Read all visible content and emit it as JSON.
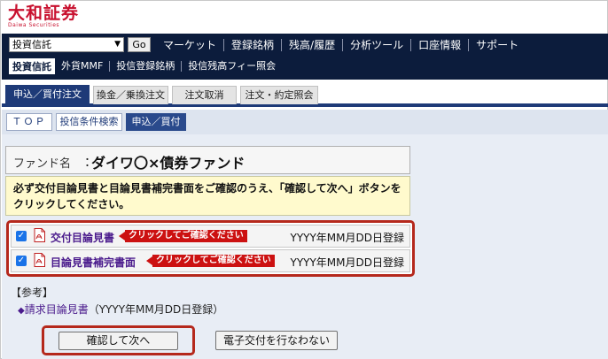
{
  "header": {
    "brand": "大和証券",
    "brand_en": "Daiwa Securities",
    "brand_color": "#c8102e"
  },
  "navbar": {
    "fund_select_value": "投資信託",
    "go_label": "Go",
    "main_items": [
      "マーケット",
      "登録銘柄",
      "残高/履歴",
      "分析ツール",
      "口座情報",
      "サポート"
    ],
    "sub_active": "投資信託",
    "sub_items": [
      "外貨MMF",
      "投信登録銘柄",
      "投信残高フィー照会"
    ]
  },
  "tabs": [
    "申込／買付注文",
    "換金／乗換注文",
    "注文取消",
    "注文・約定照会"
  ],
  "subtabs": [
    "ＴＯＰ",
    "投信条件検索",
    "申込／買付"
  ],
  "fund": {
    "label": "ファンド名",
    "colon": "：",
    "name": "ダイワ〇×債券ファンド"
  },
  "notice": "必ず交付目論見書と目論見書補完書面をご確認のうえ、「確認して次へ」ボタンをクリックしてください。",
  "documents": [
    {
      "checkbox": "✓",
      "title": "交付目論見書",
      "tag": "クリックしてご確認ください",
      "reg": "YYYY年MM月DD日登録"
    },
    {
      "checkbox": "✓",
      "title": "目論見書補完書面",
      "tag": "クリックしてご確認ください",
      "reg": "YYYY年MM月DD日登録"
    }
  ],
  "reference": {
    "heading": "【参考】",
    "bullet": "◆",
    "link": "請求目論見書",
    "suffix": "（YYYY年MM月DD日登録）"
  },
  "buttons": {
    "confirm": "確認して次へ",
    "no_electronic": "電子交付を行なわない"
  },
  "colors": {
    "navy": "#0c1c3c",
    "tab_active": "#1e3a78",
    "highlight_border": "#b5281c",
    "tag_red": "#cc1111",
    "link_purple": "#4a1a8c"
  }
}
